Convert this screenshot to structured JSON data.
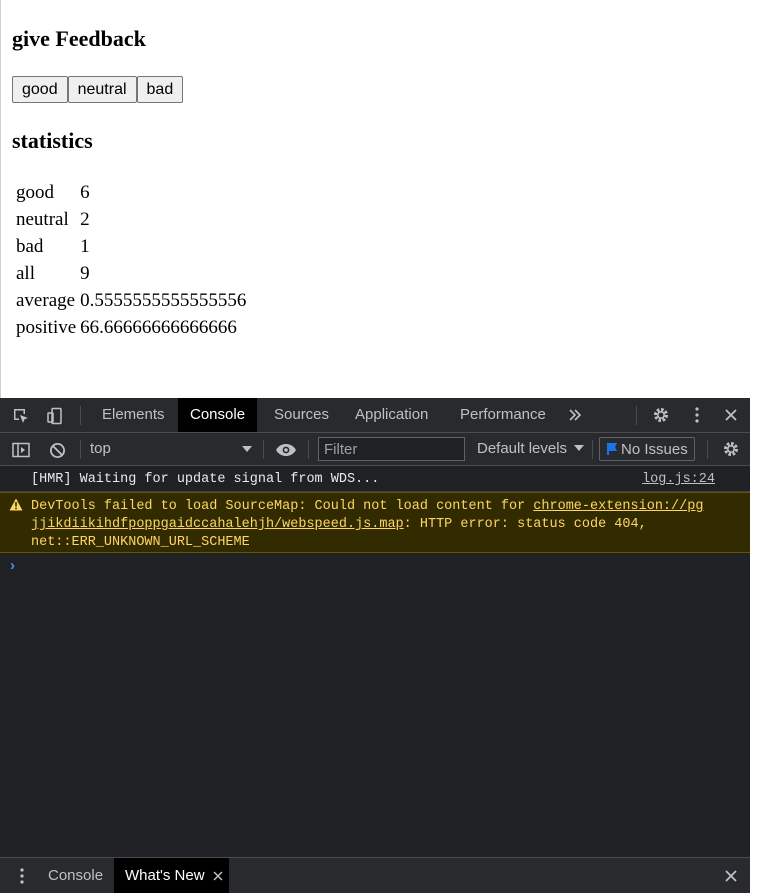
{
  "app": {
    "title": "give Feedback",
    "buttons": [
      "good",
      "neutral",
      "bad"
    ],
    "statistics_title": "statistics",
    "statistics": [
      {
        "label": "good",
        "value": "6"
      },
      {
        "label": "neutral",
        "value": "2"
      },
      {
        "label": "bad",
        "value": "1"
      },
      {
        "label": "all",
        "value": "9"
      },
      {
        "label": "average",
        "value": "0.5555555555555556"
      },
      {
        "label": "positive",
        "value": "66.66666666666666"
      }
    ]
  },
  "devtools": {
    "tabs": [
      "Elements",
      "Console",
      "Sources",
      "Application",
      "Performance"
    ],
    "active_tab": "Console",
    "context": "top",
    "filter_placeholder": "Filter",
    "levels": "Default levels",
    "issues": "No Issues",
    "log": {
      "text": "[HMR] Waiting for update signal from WDS...",
      "source": "log.js:24"
    },
    "warning": {
      "prefix": "DevTools failed to load SourceMap: Could not load content for ",
      "link_line1": "chrome-extension://pg",
      "link_line2": "jjikdiikihdfpoppgaidccahalehjh/webspeed.js.map",
      "suffix": ": HTTP error: status code 404,",
      "line3": "net::ERR_UNKNOWN_URL_SCHEME"
    },
    "drawer_tabs": [
      "Console",
      "What's New"
    ],
    "active_drawer_tab": "What's New",
    "colors": {
      "panel_bg": "#202124",
      "toolbar_bg": "#292a2d",
      "warning_bg": "#332b00",
      "warning_text": "#fdd663",
      "accent_blue": "#1a73e8"
    }
  }
}
